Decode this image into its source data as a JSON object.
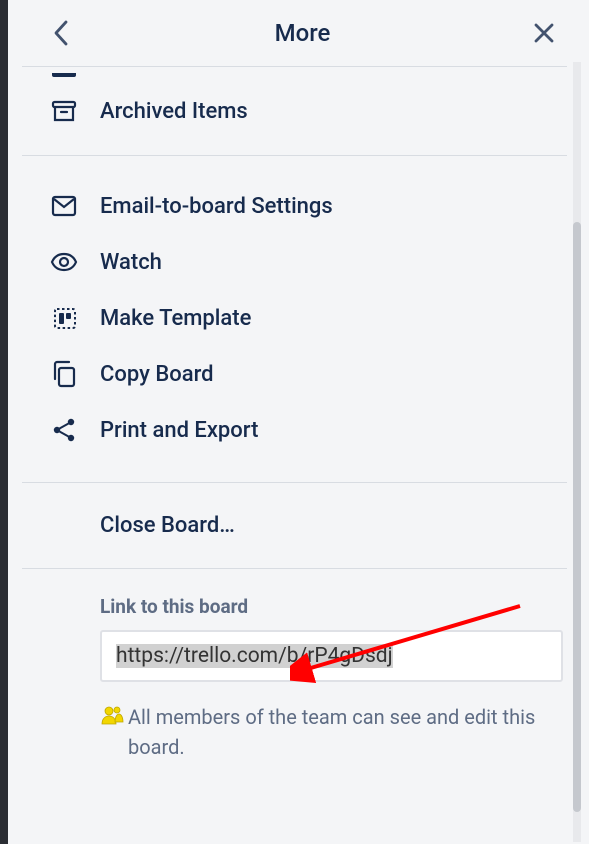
{
  "header": {
    "title": "More"
  },
  "menu": {
    "archived": {
      "label": "Archived Items"
    },
    "email": {
      "label": "Email-to-board Settings"
    },
    "watch": {
      "label": "Watch"
    },
    "template": {
      "label": "Make Template"
    },
    "copy": {
      "label": "Copy Board"
    },
    "print": {
      "label": "Print and Export"
    },
    "close": {
      "label": "Close Board…"
    }
  },
  "link": {
    "label": "Link to this board",
    "url": "https://trello.com/b/rP4gDsdj",
    "note": "All members of the team can see and edit this board."
  }
}
